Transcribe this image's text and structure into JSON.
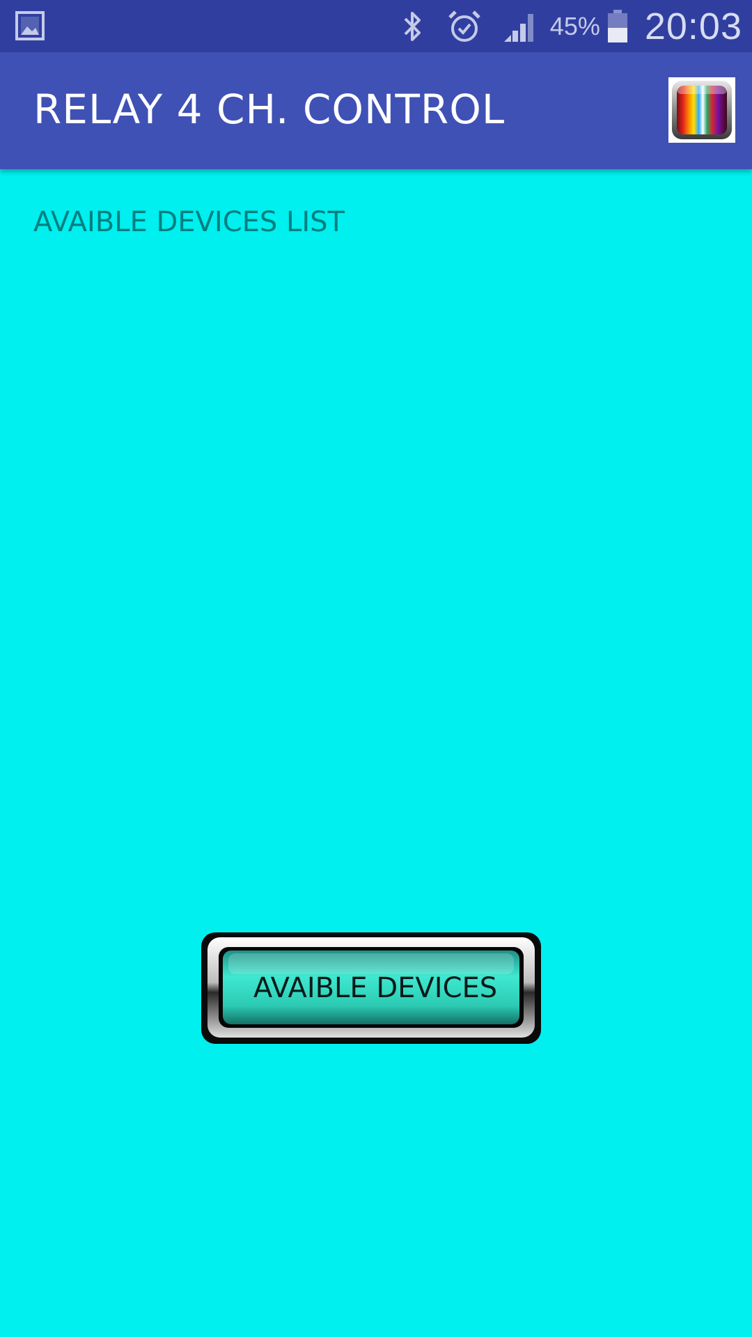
{
  "status_bar": {
    "left_icon": "gallery-notification-icon",
    "icons": [
      "bluetooth-icon",
      "alarm-icon",
      "signal-icon",
      "battery-icon"
    ],
    "battery_percent": "45%",
    "time": "20:03"
  },
  "app_bar": {
    "title": "RELAY 4 CH. CONTROL",
    "logo_icon": "rainbow-bars-icon"
  },
  "main": {
    "list_title": "AVAIBLE DEVICES LIST",
    "devices_button_label": "AVAIBLE DEVICES"
  },
  "colors": {
    "status_bar": "#303F9F",
    "app_bar": "#3F51B5",
    "background": "#00EFEF",
    "list_title_text": "#007F7F",
    "button_face": "#2FD6C0"
  }
}
